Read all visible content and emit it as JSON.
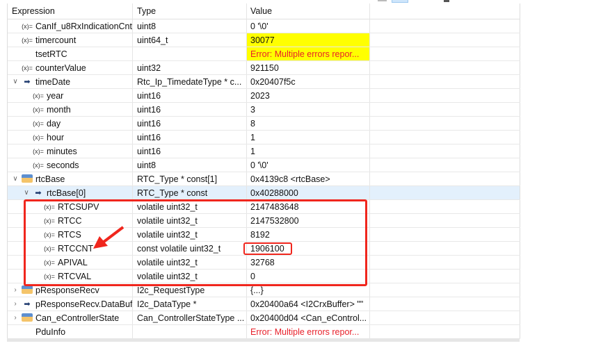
{
  "headers": {
    "expression": "Expression",
    "type": "Type",
    "value": "Value"
  },
  "rows": [
    {
      "name": "CanIf_u8RxIndicationCnt",
      "type": "uint8",
      "value": "0 '\\0'",
      "icon": "variable-icon",
      "level": 0,
      "expand": ""
    },
    {
      "name": "timercount",
      "type": "uint64_t",
      "value": "30077",
      "icon": "variable-icon",
      "level": 0,
      "expand": "",
      "highlight": true
    },
    {
      "name": "tsetRTC",
      "type": "",
      "value": "Error: Multiple errors repor...",
      "icon": "",
      "level": 0,
      "expand": "",
      "highlight": true,
      "error": true
    },
    {
      "name": "counterValue",
      "type": "uint32",
      "value": "921150",
      "icon": "variable-icon",
      "level": 0,
      "expand": ""
    },
    {
      "name": "timeDate",
      "type": "Rtc_Ip_TimedateType * c...",
      "value": "0x20407f5c",
      "icon": "pointer-icon",
      "level": 0,
      "expand": "v"
    },
    {
      "name": "year",
      "type": "uint16",
      "value": "2023",
      "icon": "variable-icon",
      "level": 1,
      "expand": ""
    },
    {
      "name": "month",
      "type": "uint16",
      "value": "3",
      "icon": "variable-icon",
      "level": 1,
      "expand": ""
    },
    {
      "name": "day",
      "type": "uint16",
      "value": "8",
      "icon": "variable-icon",
      "level": 1,
      "expand": ""
    },
    {
      "name": "hour",
      "type": "uint16",
      "value": "1",
      "icon": "variable-icon",
      "level": 1,
      "expand": ""
    },
    {
      "name": "minutes",
      "type": "uint16",
      "value": "1",
      "icon": "variable-icon",
      "level": 1,
      "expand": ""
    },
    {
      "name": "seconds",
      "type": "uint8",
      "value": "0 '\\0'",
      "icon": "variable-icon",
      "level": 1,
      "expand": ""
    },
    {
      "name": "rtcBase",
      "type": "RTC_Type * const[1]",
      "value": "0x4139c8 <rtcBase>",
      "icon": "struct-icon",
      "level": 0,
      "expand": "v"
    },
    {
      "name": "rtcBase[0]",
      "type": "RTC_Type * const",
      "value": "0x40288000",
      "icon": "pointer-icon",
      "level": 1,
      "expand": "v",
      "selected": true
    },
    {
      "name": "RTCSUPV",
      "type": "volatile uint32_t",
      "value": "2147483648",
      "icon": "variable-icon",
      "level": 2,
      "expand": ""
    },
    {
      "name": "RTCC",
      "type": "volatile uint32_t",
      "value": "2147532800",
      "icon": "variable-icon",
      "level": 2,
      "expand": ""
    },
    {
      "name": "RTCS",
      "type": "volatile uint32_t",
      "value": "8192",
      "icon": "variable-icon",
      "level": 2,
      "expand": ""
    },
    {
      "name": "RTCCNT",
      "type": "const volatile uint32_t",
      "value": "1906100",
      "icon": "variable-icon",
      "level": 2,
      "expand": ""
    },
    {
      "name": "APIVAL",
      "type": "volatile uint32_t",
      "value": "32768",
      "icon": "variable-icon",
      "level": 2,
      "expand": ""
    },
    {
      "name": "RTCVAL",
      "type": "volatile uint32_t",
      "value": "0",
      "icon": "variable-icon",
      "level": 2,
      "expand": ""
    },
    {
      "name": "pResponseRecv",
      "type": "I2c_RequestType",
      "value": "{...}",
      "icon": "struct-icon",
      "level": 0,
      "expand": ">"
    },
    {
      "name": "pResponseRecv.DataBuf",
      "type": "I2c_DataType *",
      "value": "0x20400a64 <I2CrxBuffer> \"\"",
      "icon": "pointer-icon",
      "level": 0,
      "expand": ">"
    },
    {
      "name": "Can_eControllerState",
      "type": "Can_ControllerStateType ...",
      "value": "0x20400d04 <Can_eControl...",
      "icon": "struct-icon",
      "level": 0,
      "expand": ">"
    },
    {
      "name": "PduInfo",
      "type": "",
      "value": "Error: Multiple errors repor...",
      "icon": "",
      "level": 0,
      "expand": "",
      "error": true
    }
  ],
  "colors": {
    "highlight": "#ffff00",
    "error": "#e8202a",
    "annotation": "#f0261d",
    "selected": "#e3f0fc"
  }
}
